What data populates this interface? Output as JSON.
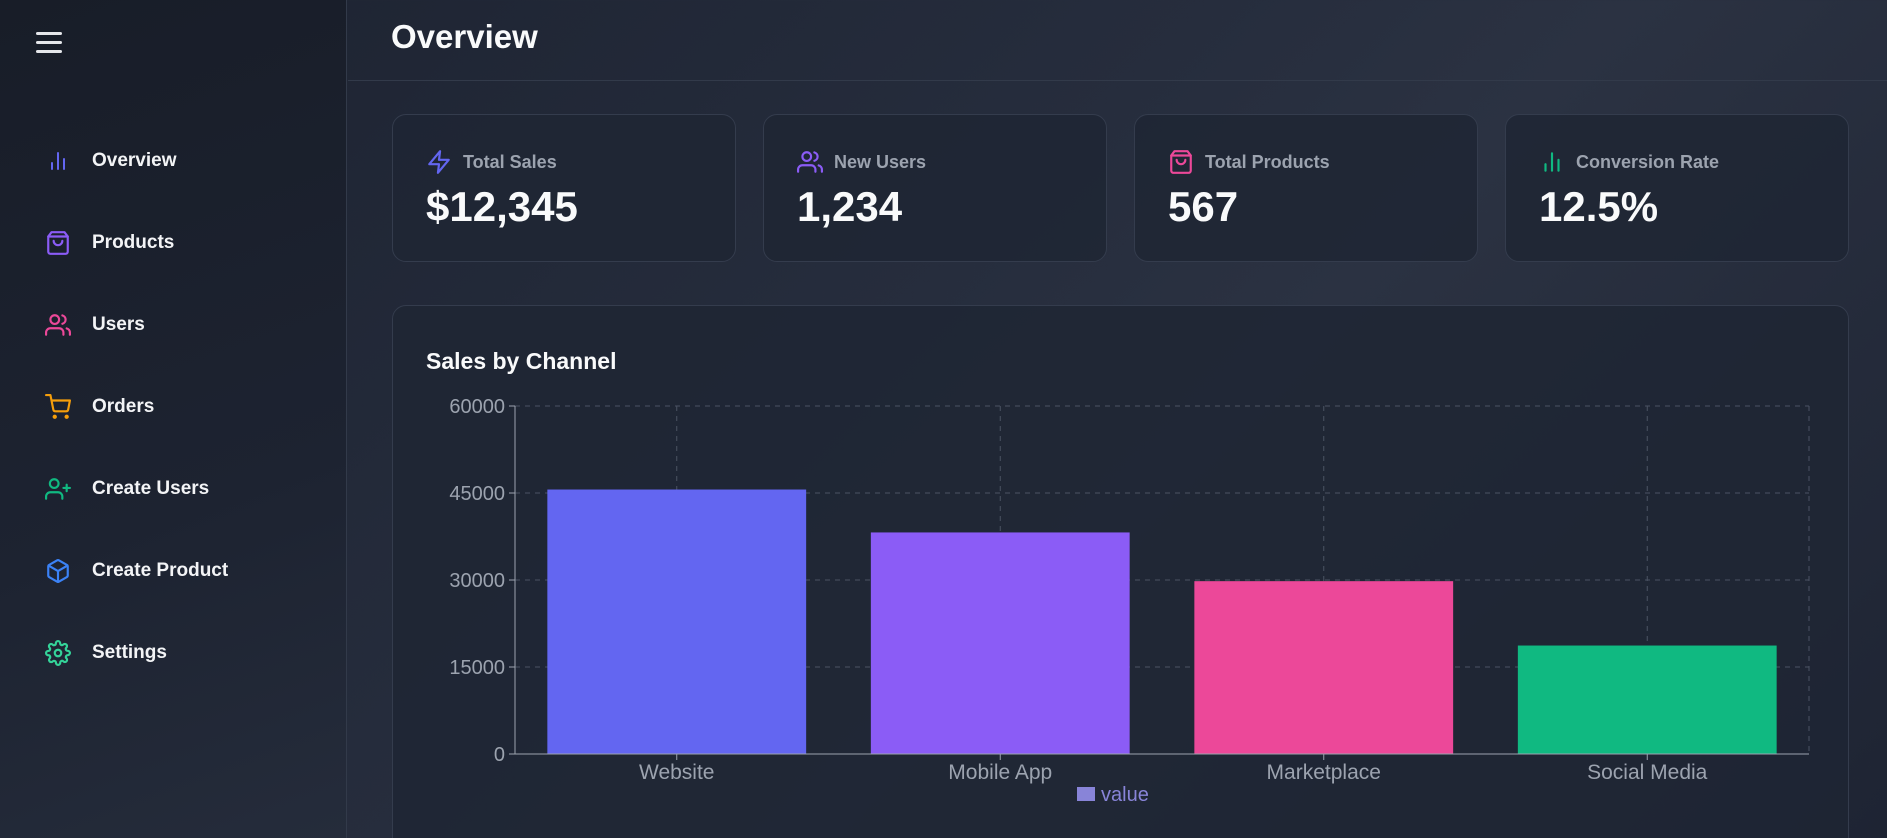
{
  "sidebar": {
    "items": [
      {
        "label": "Overview",
        "icon": "bar-chart-icon",
        "color": "#6366f1"
      },
      {
        "label": "Products",
        "icon": "shopping-bag-icon",
        "color": "#8b5cf6"
      },
      {
        "label": "Users",
        "icon": "users-icon",
        "color": "#ec4899"
      },
      {
        "label": "Orders",
        "icon": "shopping-cart-icon",
        "color": "#f59e0b"
      },
      {
        "label": "Create Users",
        "icon": "user-plus-icon",
        "color": "#10b981"
      },
      {
        "label": "Create Product",
        "icon": "package-icon",
        "color": "#3b82f6"
      },
      {
        "label": "Settings",
        "icon": "gear-icon",
        "color": "#34d399"
      }
    ]
  },
  "header": {
    "title": "Overview"
  },
  "stats": [
    {
      "label": "Total Sales",
      "value": "$12,345",
      "icon": "lightning-icon",
      "color": "#6366f1"
    },
    {
      "label": "New Users",
      "value": "1,234",
      "icon": "users-icon",
      "color": "#8b5cf6"
    },
    {
      "label": "Total Products",
      "value": "567",
      "icon": "shopping-bag-icon",
      "color": "#ec4899"
    },
    {
      "label": "Conversion Rate",
      "value": "12.5%",
      "icon": "bar-chart-icon",
      "color": "#10b981"
    }
  ],
  "chart": {
    "title": "Sales by Channel"
  },
  "chart_data": {
    "type": "bar",
    "title": "Sales by Channel",
    "categories": [
      "Website",
      "Mobile App",
      "Marketplace",
      "Social Media"
    ],
    "series": [
      {
        "name": "value",
        "values": [
          45600,
          38200,
          29800,
          18700
        ]
      }
    ],
    "colors": [
      "#6366f1",
      "#8b5cf6",
      "#ec4899",
      "#10b981"
    ],
    "legend_color": "#8884d8",
    "ylim": [
      0,
      60000
    ],
    "yticks": [
      "0",
      "15000",
      "30000",
      "45000",
      "60000"
    ],
    "grid": true,
    "legend": "bottom-center"
  }
}
